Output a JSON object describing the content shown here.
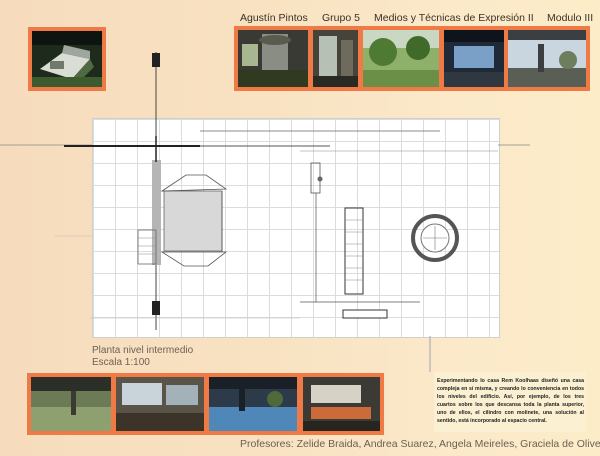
{
  "header": {
    "author": "Agustín Pintos",
    "group": "Grupo 5",
    "course": "Medios y Técnicas de Expresión II",
    "module": "Modulo III"
  },
  "plan_caption": {
    "title": "Planta nivel intermedio",
    "scale": "Escala 1:100"
  },
  "description": "Experimentando lo casa Rem Koolhaas diseñó una casa compleja en sí misma, y creando lo conveniencia en todos los niveles del edificio. Así, por ejemplo, de los tres cuartos sobre los que descansa toda la planta superior, uno de ellos, el cilindro con molinete, una solución al sentido, está incorporado al espacio central.",
  "footer": {
    "professors": "Profesores: Zelide Braida, Andrea Suarez, Angela Meireles, Graciela de Olivera"
  },
  "colors": {
    "frame": "#f07a45",
    "background": "#f8e2c2",
    "text": "#3b3126"
  }
}
